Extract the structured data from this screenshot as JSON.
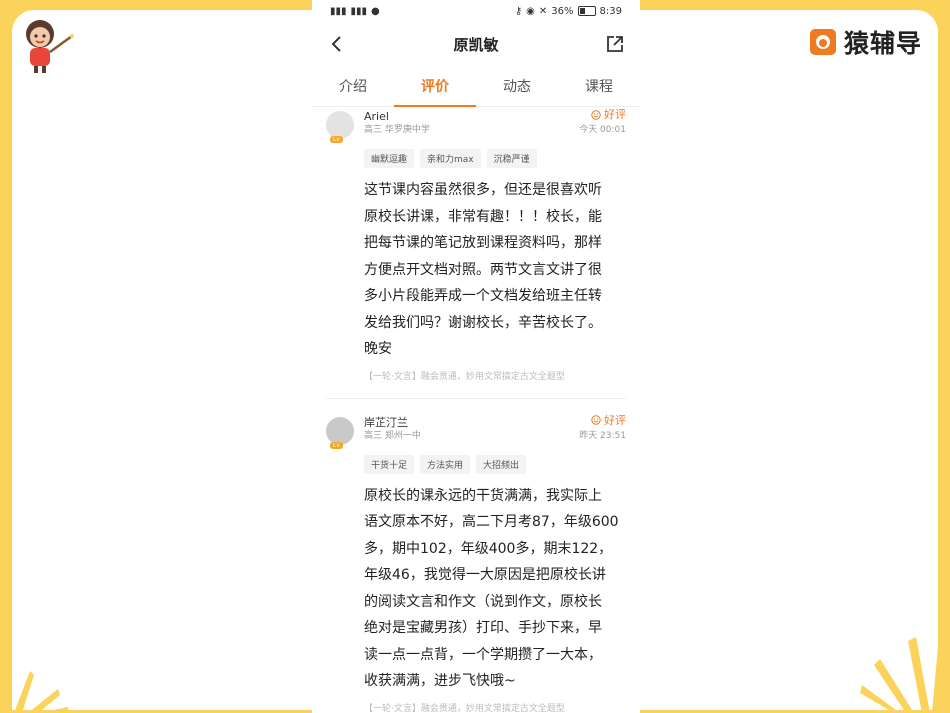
{
  "brand": {
    "name": "猿辅导",
    "accent": "#f07a22"
  },
  "statusbar": {
    "battery": "36%",
    "time": "8:39"
  },
  "header": {
    "title": "原凯敏"
  },
  "tabs": [
    {
      "label": "介绍"
    },
    {
      "label": "评价"
    },
    {
      "label": "动态"
    },
    {
      "label": "课程"
    }
  ],
  "active_tab": "评价",
  "reviews": [
    {
      "name": "Ariel",
      "school": "高三 华罗庚中学",
      "rating": "好评",
      "time": "今天 00:01",
      "tags": [
        "幽默逗趣",
        "亲和力max",
        "沉稳严谨"
      ],
      "lines": [
        "这节课内容虽然很多，但还是很喜欢听",
        "原校长讲课，非常有趣！！！校长，能",
        "把每节课的笔记放到课程资料吗，那样",
        "方便点开文档对照。两节文言文讲了很",
        "多小片段能弄成一个文档发给班主任转",
        "发给我们吗？谢谢校长，辛苦校长了。",
        "晚安"
      ],
      "course": "【一轮·文言】融会贯通，妙用文常搞定古文全题型"
    },
    {
      "name": "岸芷汀兰",
      "school": "高三 郑州一中",
      "rating": "好评",
      "time": "昨天 23:51",
      "tags": [
        "干货十足",
        "方法实用",
        "大招频出"
      ],
      "lines": [
        "原校长的课永远的干货满满，我实际上",
        "语文原本不好，高二下月考87，年级600",
        "多，期中102，年级400多，期末122，",
        "年级46，我觉得一大原因是把原校长讲",
        "的阅读文言和作文（说到作文，原校长",
        "绝对是宝藏男孩）打印、手抄下来，早",
        "读一点一点背，一个学期攒了一大本，",
        "收获满满，进步飞快哦~"
      ],
      "course": "【一轮·文言】融会贯通，妙用文常搞定古文全题型"
    }
  ]
}
